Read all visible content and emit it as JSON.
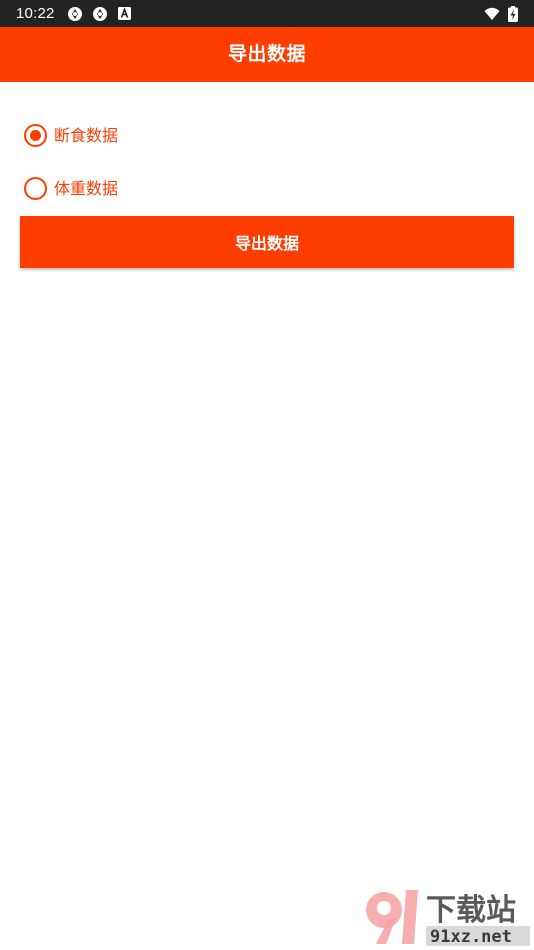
{
  "status_bar": {
    "time": "10:22",
    "icons_left": [
      "sync-icon",
      "sync-icon",
      "a-badge-icon"
    ],
    "icons_right": [
      "wifi-icon",
      "battery-charging-icon"
    ]
  },
  "app_bar": {
    "title": "导出数据"
  },
  "options": [
    {
      "label": "断食数据",
      "selected": true
    },
    {
      "label": "体重数据",
      "selected": false
    }
  ],
  "export_button": {
    "label": "导出数据"
  },
  "colors": {
    "accent": "#ff3d00",
    "status_bar_bg": "#232323",
    "background": "#ffffff"
  },
  "watermark": {
    "brand": "下载站",
    "domain": "91xz.net"
  }
}
